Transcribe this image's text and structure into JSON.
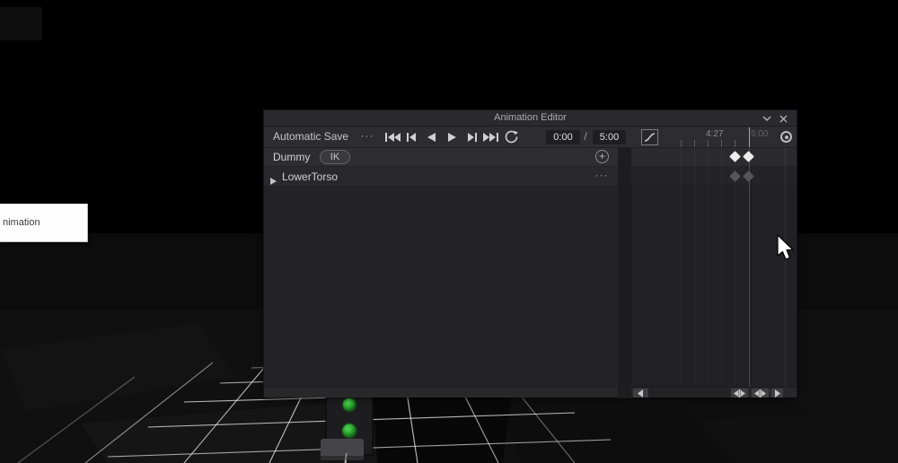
{
  "window": {
    "title": "Animation Editor"
  },
  "toolbar": {
    "save_label": "Automatic Save",
    "time_current": "0:00",
    "time_separator": "/",
    "time_total": "5:00"
  },
  "ruler": {
    "mid_label": "4:27",
    "end_label": "5:00"
  },
  "tracks": {
    "summary": {
      "name": "Dummy",
      "ik_label": "IK"
    },
    "items": [
      {
        "name": "LowerTorso"
      }
    ]
  },
  "timeline": {
    "keyframe_rows": [
      {
        "row": "Dummy",
        "keyframes": 2
      },
      {
        "row": "LowerTorso",
        "keyframes": 2
      }
    ]
  },
  "icons": {
    "ellipsis": "···",
    "plus": "+"
  },
  "tooltip": {
    "text": "nimation"
  },
  "colors": {
    "joint_green": "#2fae33",
    "keyframe_white": "#ececec",
    "keyframe_muted": "#565656",
    "panel_bg": "#232325",
    "row_highlight": "#2e2e30"
  }
}
